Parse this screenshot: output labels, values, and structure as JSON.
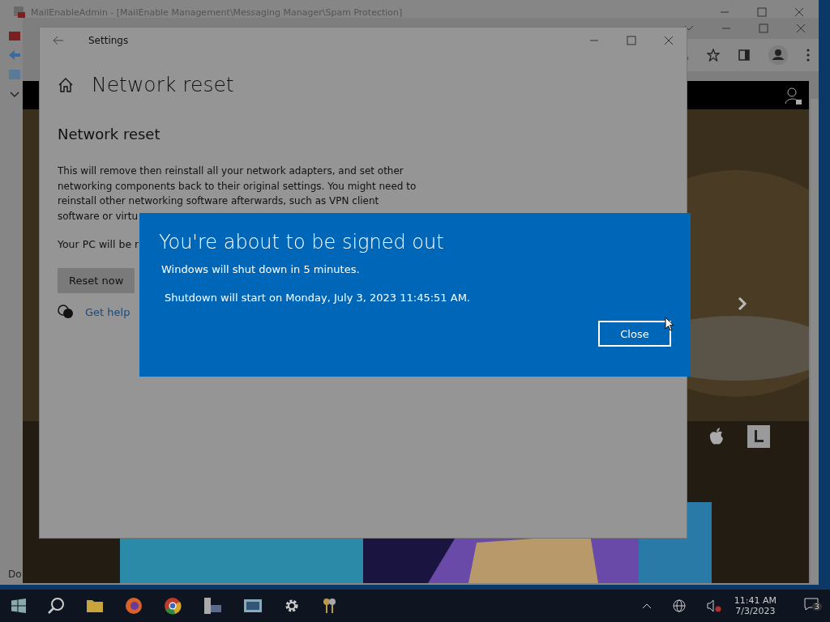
{
  "admin_window": {
    "title": "MailEnableAdmin - [MailEnable Management\\Messaging Manager\\Spam Protection]",
    "status_text": "Do"
  },
  "settings_window": {
    "title": "Settings",
    "page_title": "Network reset",
    "section_title": "Network reset",
    "description": "This will remove then reinstall all your network adapters, and set other networking components back to their original settings. You might need to reinstall other networking software afterwards, such as VPN client software or virtu",
    "note": "Your PC will be r",
    "reset_button": "Reset now",
    "help_link": "Get help"
  },
  "dialog": {
    "title": "You're about to be signed out",
    "message": "Windows will shut down in 5 minutes.",
    "detail": "Shutdown will start on Monday, July 3, 2023 11:45:51 AM.",
    "button": "Close"
  },
  "taskbar": {
    "time": "11:41 AM",
    "date": "7/3/2023",
    "notification_count": "3"
  }
}
